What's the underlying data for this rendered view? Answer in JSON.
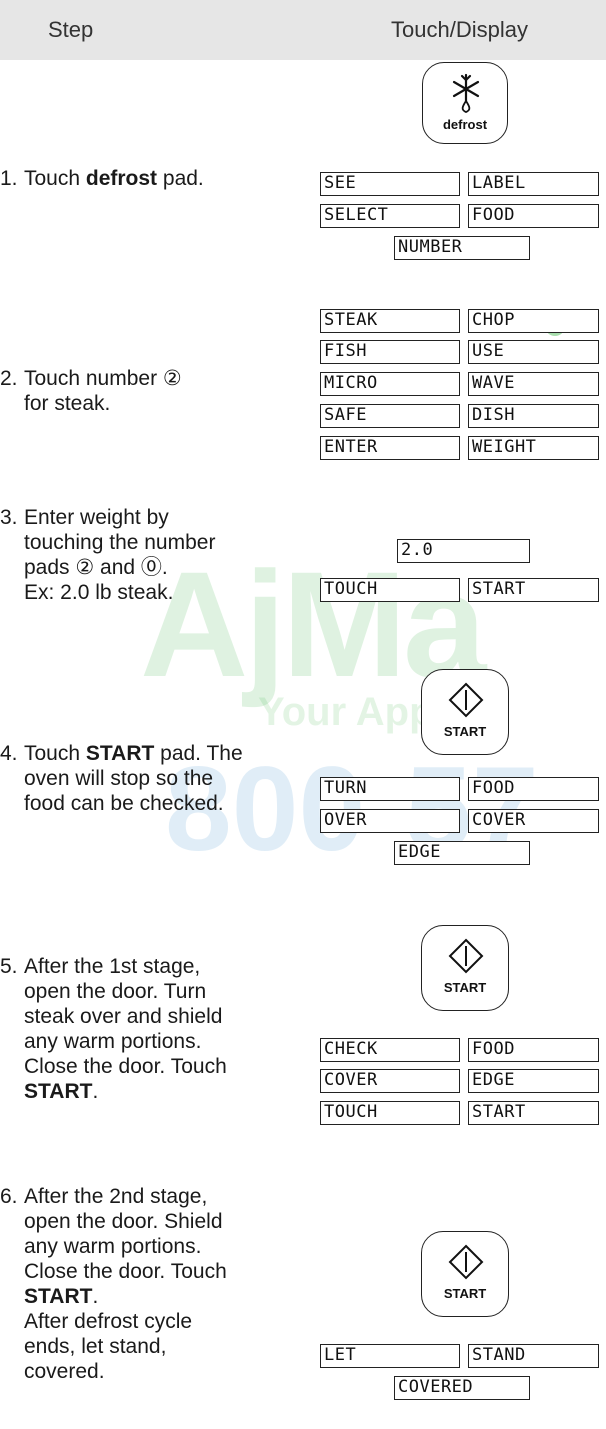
{
  "header": {
    "step_label": "Step",
    "display_label": "Touch/Display"
  },
  "watermark": {
    "logo": "AjMa",
    "tagline": "Your Appli",
    "phone": "800-57"
  },
  "steps": [
    {
      "num": "1.",
      "lines": [
        "Touch ",
        "defrost",
        " pad."
      ]
    },
    {
      "num": "2.",
      "lines": [
        "Touch number ②",
        "for steak."
      ]
    },
    {
      "num": "3.",
      "lines": [
        "Enter weight by",
        "touching the number",
        "pads ② and ⓪.",
        "Ex: 2.0 lb steak."
      ]
    },
    {
      "num": "4.",
      "lines": [
        "Touch ",
        "START",
        " pad. The",
        "oven will stop so the",
        "food can be checked."
      ]
    },
    {
      "num": "5.",
      "lines": [
        "After the 1st stage,",
        "open the door. Turn",
        "steak over and shield",
        "any warm portions.",
        "Close the door. Touch",
        "START",
        "."
      ]
    },
    {
      "num": "6.",
      "lines": [
        "After the 2nd stage,",
        "open the door. Shield",
        "any warm portions.",
        "Close the door. Touch",
        "START",
        ".",
        "After defrost cycle",
        "ends, let stand,",
        "covered."
      ]
    }
  ],
  "pads": {
    "defrost": "defrost",
    "start": "START"
  },
  "icons": {
    "defrost": "snowflake-droplet-icon",
    "start": "start-diamond-icon"
  },
  "lcd": {
    "s1": [
      "SEE",
      "LABEL",
      "SELECT",
      "FOOD",
      "NUMBER"
    ],
    "s2": [
      "STEAK",
      "CHOP",
      "FISH",
      "USE",
      "MICRO",
      "WAVE",
      "SAFE",
      "DISH",
      "ENTER",
      "WEIGHT"
    ],
    "s3": [
      "2.0",
      "TOUCH",
      "START"
    ],
    "s4": [
      "TURN",
      "FOOD",
      "OVER",
      "COVER",
      "EDGE"
    ],
    "s5": [
      "CHECK",
      "FOOD",
      "COVER",
      "EDGE",
      "TOUCH",
      "START"
    ],
    "s6": [
      "LET",
      "STAND",
      "COVERED"
    ]
  },
  "colors": {
    "header_bg": "#e6e6e6",
    "watermark_green": "#3fb54a",
    "watermark_blue": "#2e86c8"
  }
}
